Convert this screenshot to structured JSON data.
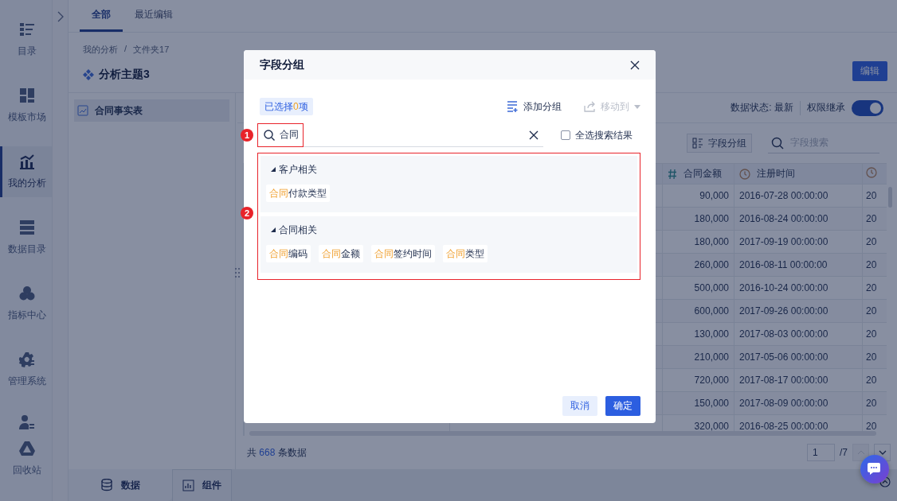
{
  "sidebar": {
    "items": [
      {
        "label": "目录",
        "selected": false
      },
      {
        "label": "模板市场",
        "selected": false
      },
      {
        "label": "我的分析",
        "selected": true
      },
      {
        "label": "数据目录",
        "selected": false
      },
      {
        "label": "指标中心",
        "selected": false
      },
      {
        "label": "管理系统",
        "selected": false
      },
      {
        "selected": false
      },
      {
        "label": "回收站",
        "selected": false
      }
    ]
  },
  "tabs": [
    {
      "label": "全部",
      "selected": true
    },
    {
      "label": "最近编辑",
      "selected": false
    }
  ],
  "breadcrumb": {
    "items": [
      "我的分析",
      "文件夹17"
    ],
    "separator": "/"
  },
  "title": "分析主题3",
  "edit_button": "编辑",
  "tables_list": [
    {
      "label": "合同事实表",
      "selected": true
    }
  ],
  "data_status": "数据状态: 最新",
  "permission": {
    "label": "权限继承",
    "on": true
  },
  "field_group_button": "字段分组",
  "field_search": {
    "placeholder": "字段搜索"
  },
  "table": {
    "columns": [
      {
        "label": "合同金额",
        "kind": "number"
      },
      {
        "label": "注册时间",
        "kind": "time"
      },
      {
        "kind": "time"
      }
    ],
    "rows": [
      [
        "90,000",
        "2016-07-28 00:00:00",
        "20"
      ],
      [
        "180,000",
        "2016-08-24 00:00:00",
        "20"
      ],
      [
        "180,000",
        "2017-09-19 00:00:00",
        "20"
      ],
      [
        "260,000",
        "2016-08-11 00:00:00",
        "20"
      ],
      [
        "500,000",
        "2016-10-24 00:00:00",
        "20"
      ],
      [
        "600,000",
        "2017-09-26 00:00:00",
        "20"
      ],
      [
        "130,000",
        "2017-08-03 00:00:00",
        "20"
      ],
      [
        "210,000",
        "2017-05-06 00:00:00",
        "20"
      ],
      [
        "720,000",
        "2017-08-17 00:00:00",
        "20"
      ],
      [
        "150,000",
        "2017-08-09 00:00:00",
        "20"
      ],
      [
        "320,000",
        "2016-08-25 00:00:00",
        "20"
      ]
    ]
  },
  "footer": {
    "prefix": "共",
    "count": "668",
    "suffix": "条数据"
  },
  "pagination": {
    "page": "1",
    "total": "/7",
    "prev_disabled": true
  },
  "bottom_tabs": [
    {
      "label": "数据",
      "selected": true
    },
    {
      "label": "组件",
      "selected": false
    }
  ],
  "dialog": {
    "title": "字段分组",
    "selected_count": {
      "prefix": "已选择",
      "count": "0",
      "suffix": "项"
    },
    "actions": [
      {
        "label": "添加分组",
        "disabled": false
      },
      {
        "label": "移动到",
        "disabled": true
      }
    ],
    "search": {
      "value": "合同"
    },
    "select_all": {
      "label": "全选搜索结果",
      "checked": false
    },
    "annotations": [
      {
        "label": "1"
      },
      {
        "label": "2"
      }
    ],
    "groups": [
      {
        "name": "客户相关",
        "expanded": true,
        "fields": [
          {
            "match": "合同",
            "rest": "付款类型"
          }
        ]
      },
      {
        "name": "合同相关",
        "expanded": true,
        "fields": [
          {
            "match": "合同",
            "rest": "编码"
          },
          {
            "match": "合同",
            "rest": "金额"
          },
          {
            "match": "合同",
            "rest": "签约时间"
          },
          {
            "match": "合同",
            "rest": "类型"
          }
        ]
      }
    ],
    "buttons": [
      {
        "label": "取消",
        "kind": "secondary"
      },
      {
        "label": "确定",
        "kind": "primary"
      }
    ]
  }
}
